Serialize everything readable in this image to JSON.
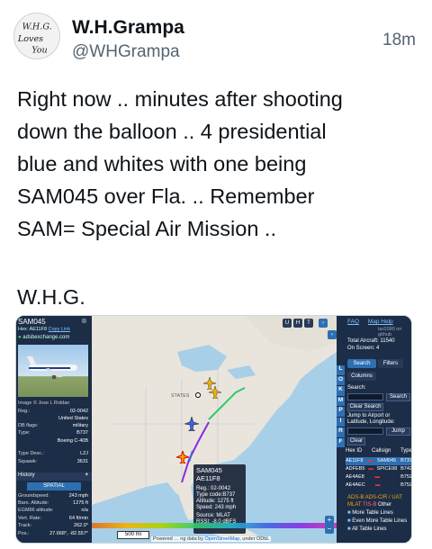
{
  "tweet": {
    "display_name": "W.H.Grampa",
    "handle": "@WHGrampa",
    "time": "18m",
    "avatar_text": "W.H.G. Loves You",
    "text": "Right now .. minutes after shooting\ndown the balloon .. 4 presidential\nblue and whites with one being\nSAM045 over Fla. .. Remember\nSAM= Special Air Mission ..",
    "signature": "W.H.G."
  },
  "left_panel": {
    "callsign": "SAM045",
    "hex_label": "Hex: AE11F8",
    "copy_link": "Copy Link",
    "source": "adsbexchange.com",
    "image_credit": "Image © Jose L Roldan",
    "reg_label": "Reg.:",
    "reg_value": "02-0042",
    "country": "United States",
    "db_flags_label": "DB flags:",
    "db_flags_value": "military",
    "type_label": "Type:",
    "type_value": "B737",
    "type_full": "Boeing C-40B",
    "type_desc_label": "Type Desc.:",
    "type_desc_value": "L2J",
    "squawk_label": "Squawk:",
    "squawk_value": "3631",
    "history_label": "History",
    "history_add": "+",
    "spatial_label": "SPATIAL",
    "groundspeed_label": "Groundspeed:",
    "groundspeed_value": "243 mph",
    "baro_label": "Baro. Altitude:",
    "baro_value": "1275 ft",
    "egm_label": "EGM96 altitude:",
    "egm_value": "n/a",
    "vert_label": "Vert. Rate:",
    "vert_value": "64 ft/min",
    "track_label": "Track:",
    "track_value": "262.0°",
    "pos_label": "Pos.:",
    "pos_value": "27.668°, -82.557°"
  },
  "map": {
    "top_buttons": [
      "U",
      "H",
      "T"
    ],
    "states_label": "STATES",
    "info_box": {
      "callsign": "SAM045",
      "hex": "AE11F8",
      "reg": "Reg.: 02-0042",
      "type": "Type code:B737",
      "alt": "Altitude: 1275 ft",
      "speed": "Speed: 243 mph",
      "source": "Source:   MLAT",
      "rssi": "RSSI: -8.0 dBFS"
    },
    "scale_label": "500 mi",
    "attribution_prefix": "Powered",
    "attribution_mid": "ng data by ",
    "attribution_link": "OpenStreetMap",
    "attribution_suffix": ", under ODbL"
  },
  "right_panel": {
    "faq": "FAQ",
    "map_help": "Map Help",
    "github": "tar1090 on github",
    "total_aircraft": "Total Aircraft: 11540",
    "on_screen": "On Screen: 4",
    "search_tab": "Search",
    "filters_tab": "Filters",
    "columns_tab": "Columns",
    "side_letters": [
      "L",
      "O",
      "K",
      "M",
      "P",
      "I",
      "R",
      "F"
    ],
    "search_label": "Search:",
    "search_button": "Search",
    "clear_search": "Clear Search",
    "jump_label": "Jump to Airport or Latitude, Longitude:",
    "jump_button": "Jump",
    "clear_button": "Clear",
    "table_headers": [
      "Hex ID",
      "Callsign",
      "Type"
    ],
    "table_rows": [
      {
        "hex": "AE11F8",
        "callsign": "SAM045",
        "type": "B737"
      },
      {
        "hex": "ADFEB5",
        "callsign": "SPICE98",
        "type": "B742"
      },
      {
        "hex": "AE4AE8",
        "callsign": "",
        "type": "B752"
      },
      {
        "hex": "AE4AEC",
        "callsign": "",
        "type": "B752"
      }
    ],
    "legend_line1": "ADS-B  ADS-C/R / UAT",
    "legend_line2a": "MLAT",
    "legend_line2b": "TIS-B",
    "legend_line2c": "Other",
    "more_lines": "More Table Lines",
    "even_more_lines": "Even More Table Lines",
    "all_lines": "All Table Lines"
  }
}
